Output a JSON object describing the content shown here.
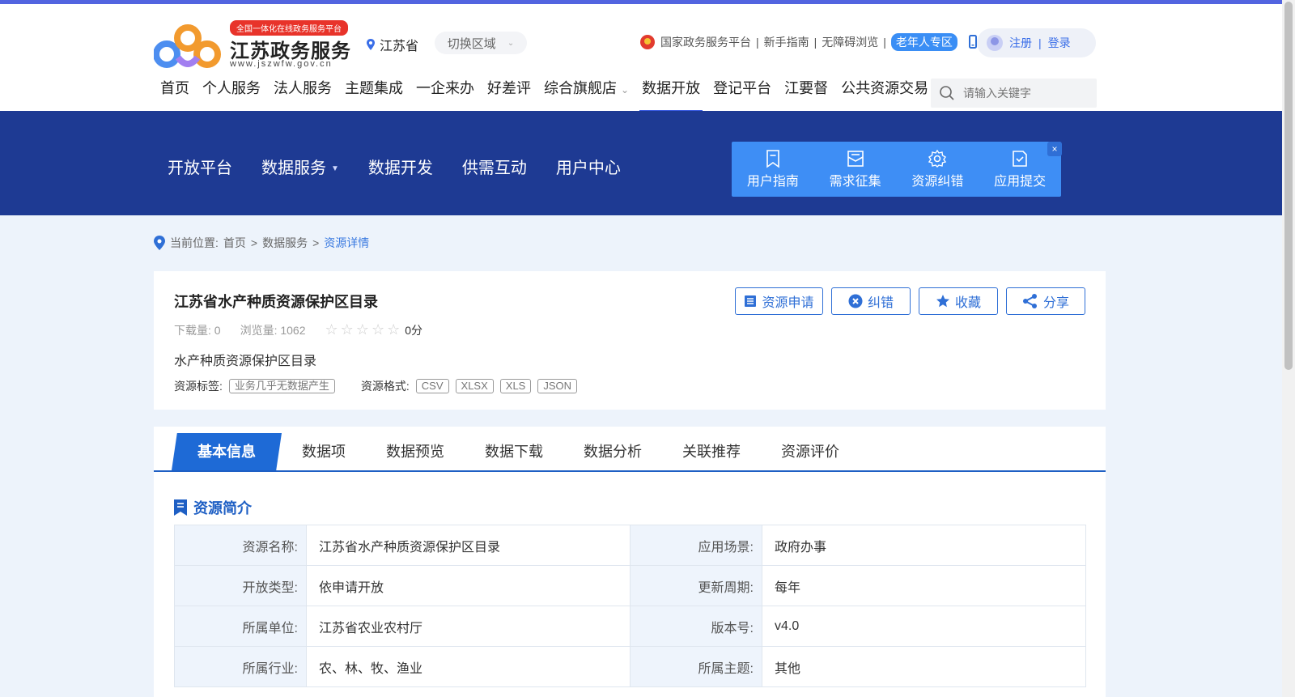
{
  "header": {
    "logo_badge": "全国一体化在线政务服务平台",
    "logo_name": "江苏政务服务",
    "logo_url": "www.jszwfw.gov.cn",
    "region": "江苏省",
    "switch_region": "切换区域",
    "links": {
      "national": "国家政务服务平台",
      "sep1": "|",
      "guide": "新手指南",
      "sep2": "|",
      "accessible": "无障碍浏览",
      "sep3": "|",
      "elder": "老年人专区"
    },
    "register": "注册",
    "login_sep": "|",
    "login": "登录"
  },
  "main_nav": [
    "首页",
    "个人服务",
    "法人服务",
    "主题集成",
    "一企来办",
    "好差评",
    "综合旗舰店",
    "数据开放",
    "登记平台",
    "江要督",
    "公共资源交易"
  ],
  "search": {
    "placeholder": "请输入关键字"
  },
  "subnav": [
    "开放平台",
    "数据服务",
    "数据开发",
    "供需互动",
    "用户中心"
  ],
  "quick": [
    "用户指南",
    "需求征集",
    "资源纠错",
    "应用提交"
  ],
  "quick_close": "×",
  "breadcrumb": {
    "label": "当前位置:",
    "home": "首页",
    "sep": ">",
    "level1": "数据服务",
    "current": "资源详情"
  },
  "resource": {
    "title": "江苏省水产种质资源保护区目录",
    "downloads_label": "下载量:",
    "downloads": "0",
    "views_label": "浏览量:",
    "views": "1062",
    "rating": 0,
    "score": "0分",
    "description": "水产种质资源保护区目录",
    "tags_label": "资源标签:",
    "tags": [
      "业务几乎无数据产生"
    ],
    "formats_label": "资源格式:",
    "formats": [
      "CSV",
      "XLSX",
      "XLS",
      "JSON"
    ]
  },
  "actions": {
    "apply": "资源申请",
    "correct": "纠错",
    "favorite": "收藏",
    "share": "分享"
  },
  "tabs": [
    "基本信息",
    "数据项",
    "数据预览",
    "数据下载",
    "数据分析",
    "关联推荐",
    "资源评价"
  ],
  "section_title": "资源简介",
  "info_rows": [
    {
      "k1": "资源名称:",
      "v1": "江苏省水产种质资源保护区目录",
      "k2": "应用场景:",
      "v2": "政府办事"
    },
    {
      "k1": "开放类型:",
      "v1": "依申请开放",
      "k2": "更新周期:",
      "v2": "每年"
    },
    {
      "k1": "所属单位:",
      "v1": "江苏省农业农村厅",
      "k2": "版本号:",
      "v2": "v4.0"
    },
    {
      "k1": "所属行业:",
      "v1": "农、林、牧、渔业",
      "k2": "所属主题:",
      "v2": "其他"
    }
  ],
  "colors": {
    "topbar": "#5264e0",
    "banner": "#1e3a93",
    "quickbox": "#3e8ef5",
    "accent": "#1e6ad6"
  }
}
